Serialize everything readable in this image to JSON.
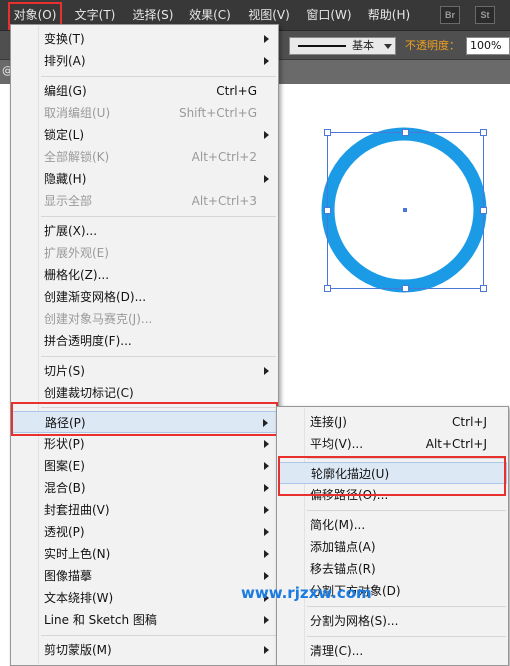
{
  "menubar": {
    "items": [
      {
        "label": "对象(O)"
      },
      {
        "label": "文字(T)"
      },
      {
        "label": "选择(S)"
      },
      {
        "label": "效果(C)"
      },
      {
        "label": "视图(V)"
      },
      {
        "label": "窗口(W)"
      },
      {
        "label": "帮助(H)"
      }
    ],
    "app_buttons": [
      "Br",
      "St"
    ]
  },
  "controlbar": {
    "stroke_style": "基本",
    "opacity_label": "不透明度：",
    "opacity_value": "100%"
  },
  "object_menu": {
    "items": [
      {
        "label": "变换(T)",
        "shortcut": "",
        "submenu": true,
        "enabled": true
      },
      {
        "label": "排列(A)",
        "shortcut": "",
        "submenu": true,
        "enabled": true
      },
      {
        "label": "编组(G)",
        "shortcut": "Ctrl+G",
        "submenu": false,
        "enabled": true
      },
      {
        "label": "取消编组(U)",
        "shortcut": "Shift+Ctrl+G",
        "submenu": false,
        "enabled": false
      },
      {
        "label": "锁定(L)",
        "shortcut": "",
        "submenu": true,
        "enabled": true
      },
      {
        "label": "全部解锁(K)",
        "shortcut": "Alt+Ctrl+2",
        "submenu": false,
        "enabled": false
      },
      {
        "label": "隐藏(H)",
        "shortcut": "",
        "submenu": true,
        "enabled": true
      },
      {
        "label": "显示全部",
        "shortcut": "Alt+Ctrl+3",
        "submenu": false,
        "enabled": false
      },
      {
        "label": "扩展(X)...",
        "shortcut": "",
        "submenu": false,
        "enabled": true
      },
      {
        "label": "扩展外观(E)",
        "shortcut": "",
        "submenu": false,
        "enabled": false
      },
      {
        "label": "栅格化(Z)...",
        "shortcut": "",
        "submenu": false,
        "enabled": true
      },
      {
        "label": "创建渐变网格(D)...",
        "shortcut": "",
        "submenu": false,
        "enabled": true
      },
      {
        "label": "创建对象马赛克(J)...",
        "shortcut": "",
        "submenu": false,
        "enabled": false
      },
      {
        "label": "拼合透明度(F)...",
        "shortcut": "",
        "submenu": false,
        "enabled": true
      },
      {
        "label": "切片(S)",
        "shortcut": "",
        "submenu": true,
        "enabled": true
      },
      {
        "label": "创建裁切标记(C)",
        "shortcut": "",
        "submenu": false,
        "enabled": true
      },
      {
        "label": "路径(P)",
        "shortcut": "",
        "submenu": true,
        "enabled": true
      },
      {
        "label": "形状(P)",
        "shortcut": "",
        "submenu": true,
        "enabled": true
      },
      {
        "label": "图案(E)",
        "shortcut": "",
        "submenu": true,
        "enabled": true
      },
      {
        "label": "混合(B)",
        "shortcut": "",
        "submenu": true,
        "enabled": true
      },
      {
        "label": "封套扭曲(V)",
        "shortcut": "",
        "submenu": true,
        "enabled": true
      },
      {
        "label": "透视(P)",
        "shortcut": "",
        "submenu": true,
        "enabled": true
      },
      {
        "label": "实时上色(N)",
        "shortcut": "",
        "submenu": true,
        "enabled": true
      },
      {
        "label": "图像描摹",
        "shortcut": "",
        "submenu": true,
        "enabled": true
      },
      {
        "label": "文本绕排(W)",
        "shortcut": "",
        "submenu": true,
        "enabled": true
      },
      {
        "label": "Line 和 Sketch 图稿",
        "shortcut": "",
        "submenu": true,
        "enabled": true
      },
      {
        "label": "剪切蒙版(M)",
        "shortcut": "",
        "submenu": true,
        "enabled": true
      }
    ]
  },
  "path_submenu": {
    "items": [
      {
        "label": "连接(J)",
        "shortcut": "Ctrl+J"
      },
      {
        "label": "平均(V)...",
        "shortcut": "Alt+Ctrl+J"
      },
      {
        "label": "轮廓化描边(U)",
        "shortcut": ""
      },
      {
        "label": "偏移路径(O)...",
        "shortcut": ""
      },
      {
        "label": "简化(M)...",
        "shortcut": ""
      },
      {
        "label": "添加锚点(A)",
        "shortcut": ""
      },
      {
        "label": "移去锚点(R)",
        "shortcut": ""
      },
      {
        "label": "分割下方对象(D)",
        "shortcut": ""
      },
      {
        "label": "分割为网格(S)...",
        "shortcut": ""
      },
      {
        "label": "清理(C)...",
        "shortcut": ""
      }
    ]
  },
  "artwork": {
    "stroke_color": "#1b9be6",
    "selection_color": "#4a78d8"
  },
  "watermark": "www.rjzxw.com"
}
